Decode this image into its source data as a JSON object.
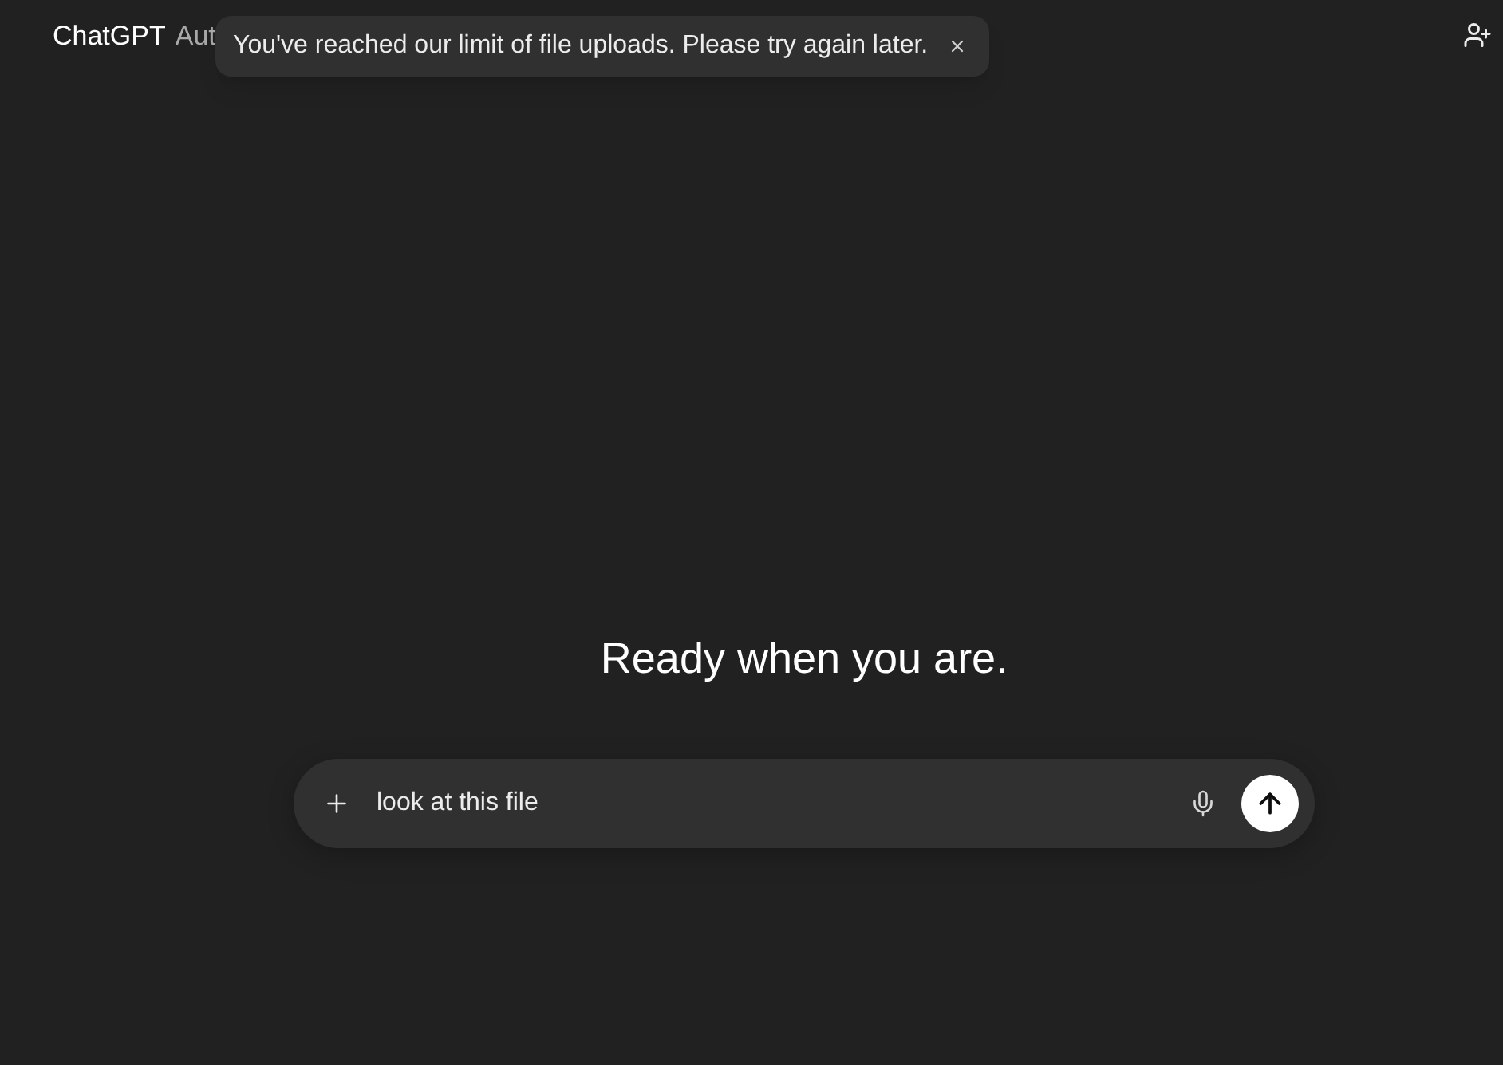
{
  "header": {
    "title": "ChatGPT",
    "model_label": "Aut"
  },
  "toast": {
    "message": "You've reached our limit of file uploads. Please try again later."
  },
  "main": {
    "heading": "Ready when you are."
  },
  "composer": {
    "value": "look at this file"
  }
}
